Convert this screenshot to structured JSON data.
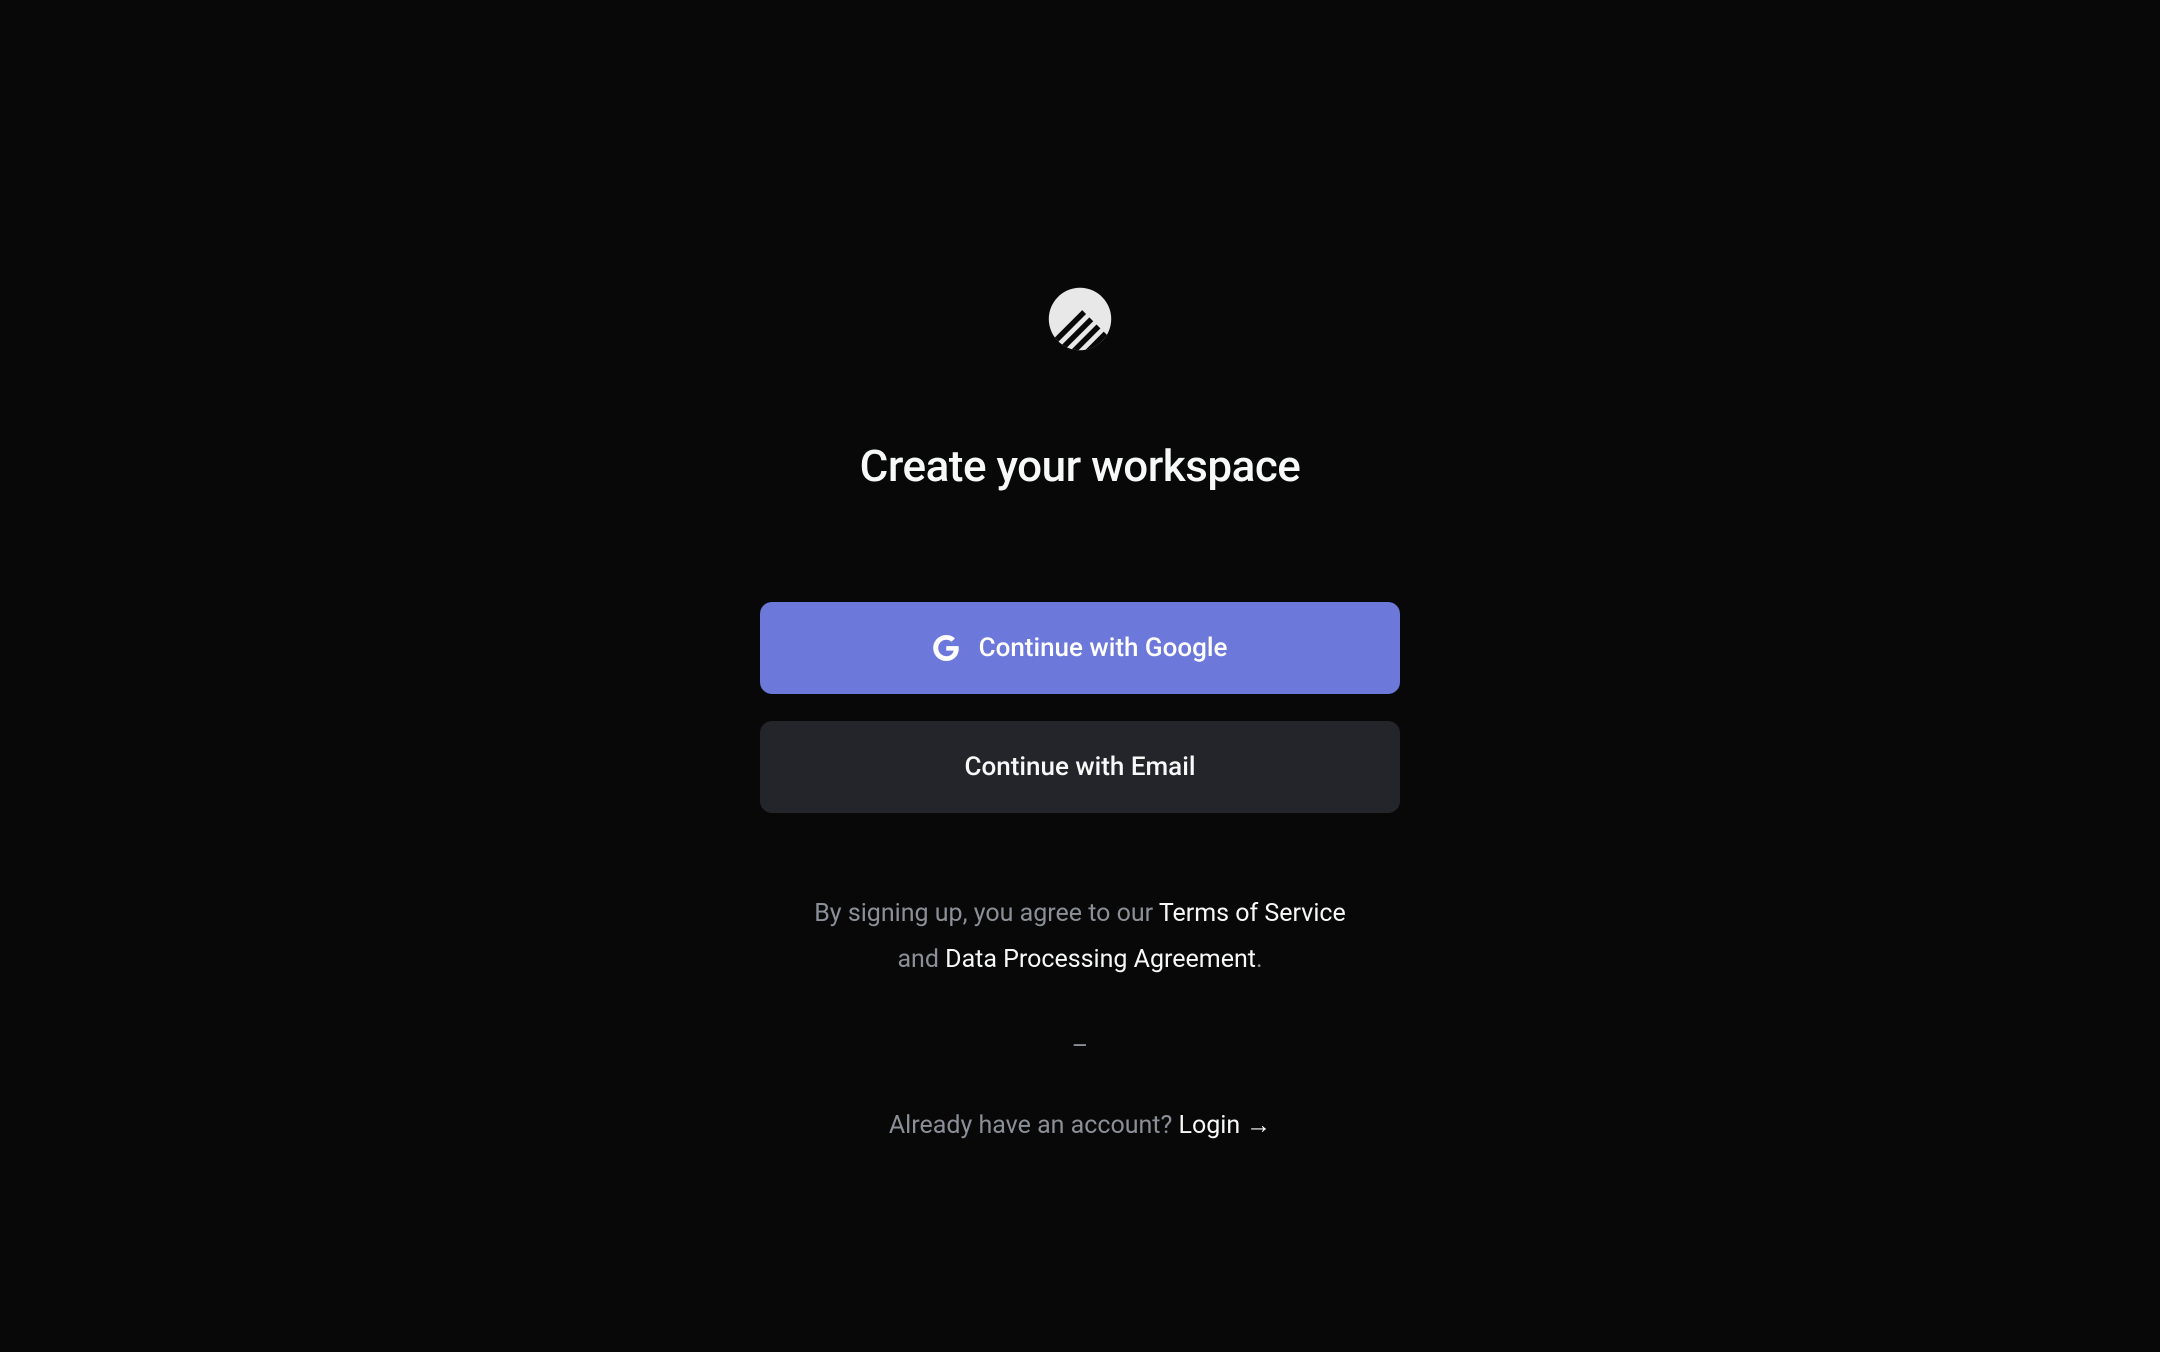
{
  "heading": "Create your workspace",
  "buttons": {
    "google_label": "Continue with Google",
    "email_label": "Continue with Email"
  },
  "legal": {
    "prefix": "By signing up, you agree to our ",
    "tos": "Terms of Service",
    "and": " and ",
    "dpa": "Data Processing Agreement",
    "period": "."
  },
  "divider": "–",
  "login": {
    "prompt": "Already have an account? ",
    "link": "Login",
    "arrow": "→"
  }
}
